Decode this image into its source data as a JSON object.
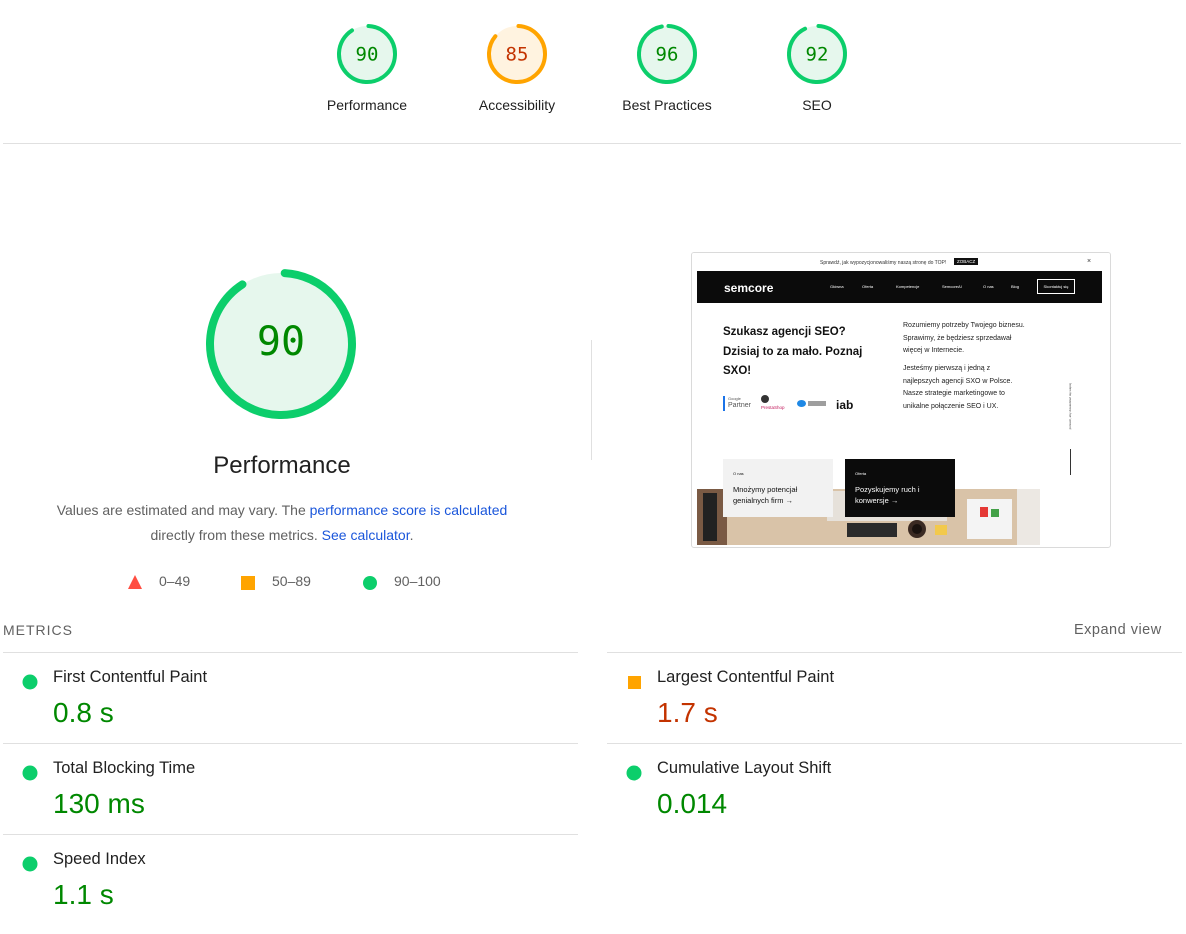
{
  "categories": [
    {
      "label": "Performance",
      "score": "90",
      "value": 90,
      "rating": "pass"
    },
    {
      "label": "Accessibility",
      "score": "85",
      "value": 85,
      "rating": "average"
    },
    {
      "label": "Best Practices",
      "score": "96",
      "value": 96,
      "rating": "pass"
    },
    {
      "label": "SEO",
      "score": "92",
      "value": 92,
      "rating": "pass"
    }
  ],
  "colors": {
    "pass": "#0cce6b",
    "pass_text": "#008800",
    "pass_fill": "#e6f7ed",
    "average": "#ffa400",
    "average_text": "#c33300",
    "average_fill": "#fff3e0",
    "fail": "#ff4e42",
    "link": "#1a56db"
  },
  "performance": {
    "score": "90",
    "value": 90,
    "title": "Performance",
    "desc_prefix": "Values are estimated and may vary. The ",
    "desc_link": "performance score is calculated",
    "desc_middle": " directly from these metrics. ",
    "desc_link2": "See calculator",
    "desc_suffix": "."
  },
  "legend": [
    {
      "icon": "fail-triangle-icon",
      "range": "0–49"
    },
    {
      "icon": "average-square-icon",
      "range": "50–89"
    },
    {
      "icon": "pass-circle-icon",
      "range": "90–100"
    }
  ],
  "screenshot": {
    "banner": "Sprawdź, jak wypozycjonowaliśmy naszą stronę do TOP!",
    "banner_cta": "ZOBACZ",
    "logo": "semcore",
    "menu": [
      "Główna",
      "Oferta",
      "Kompetencje",
      "SemcoreAI",
      "O nas",
      "Blog"
    ],
    "contact_button": "Skontaktuj się",
    "headline": "Szukasz agencji SEO? Dzisiaj to za mało. Poznaj SXO!",
    "para1": "Rozumiemy potrzeby Twojego biznesu. Sprawimy, że będziesz sprzedawał więcej w Internecie.",
    "para2": "Jesteśmy pierwszą i jedną z najlepszych agencji SXO w Polsce. Nasze strategie marketingowe to unikalne połączenie SEO i UX.",
    "partners": [
      "Google",
      "Partner",
      "PrestaShop",
      "iab"
    ],
    "card1_cat": "O nas",
    "card1_text": "Mnożymy potencjał genialnych firm →",
    "card2_cat": "Oferta",
    "card2_text": "Pozyskujemy ruch i konwersje →",
    "scroll_text": "przewiń, aby dowiedzieć się więcej"
  },
  "metrics": {
    "title": "METRICS",
    "expand_label": "Expand view",
    "items": [
      {
        "label": "First Contentful Paint",
        "value": "0.8 s",
        "rating": "pass"
      },
      {
        "label": "Largest Contentful Paint",
        "value": "1.7 s",
        "rating": "average"
      },
      {
        "label": "Total Blocking Time",
        "value": "130 ms",
        "rating": "pass"
      },
      {
        "label": "Cumulative Layout Shift",
        "value": "0.014",
        "rating": "pass"
      },
      {
        "label": "Speed Index",
        "value": "1.1 s",
        "rating": "pass"
      }
    ]
  }
}
